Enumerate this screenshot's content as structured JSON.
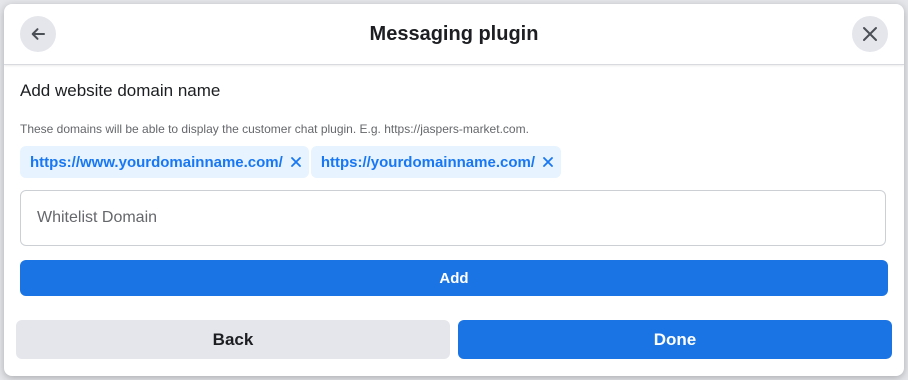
{
  "header": {
    "title": "Messaging plugin",
    "back_icon": "arrow-left-icon",
    "close_icon": "close-icon"
  },
  "section": {
    "title": "Add website domain name",
    "hint": "These domains will be able to display the customer chat plugin. E.g. https://jaspers-market.com."
  },
  "domains": [
    {
      "label": "https://www.yourdomainname.com/",
      "remove_icon": "close-icon"
    },
    {
      "label": "https://yourdomainname.com/",
      "remove_icon": "close-icon"
    }
  ],
  "input": {
    "placeholder": "Whitelist Domain",
    "value": ""
  },
  "buttons": {
    "add": "Add",
    "back": "Back",
    "done": "Done"
  },
  "colors": {
    "primary": "#1b74e4",
    "chip_bg": "#e7f3ff",
    "chip_text": "#1877f2",
    "secondary_bg": "#e4e6eb",
    "text": "#1c1e21",
    "muted_text": "#65676b"
  }
}
